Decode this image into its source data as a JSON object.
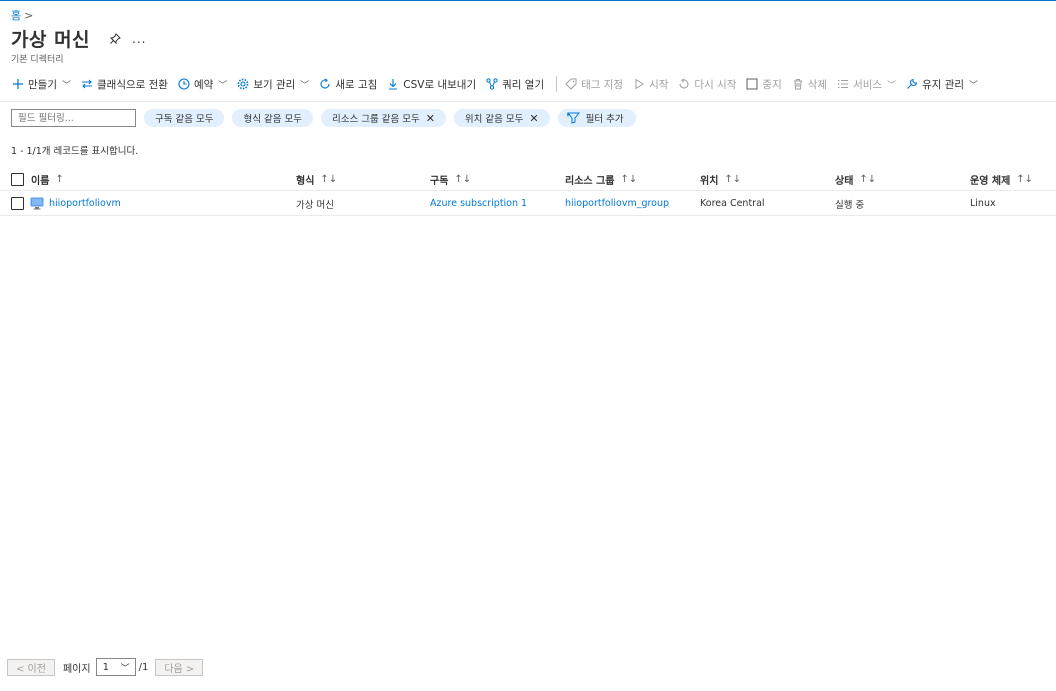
{
  "breadcrumb": {
    "home": "홈",
    "separator": ">"
  },
  "page": {
    "title": "가상 머신",
    "more": "...",
    "subtitle": "기본 디렉터리"
  },
  "toolbar": {
    "create": "만들기",
    "classic": "클래식으로 전환",
    "reservation": "예약",
    "view_manage": "보기 관리",
    "refresh": "새로 고침",
    "export_csv": "CSV로 내보내기",
    "open_query": "쿼리 열기",
    "assign_tags": "태그 지정",
    "start": "시작",
    "restart": "다시 시작",
    "stop": "중지",
    "delete": "삭제",
    "services": "서비스",
    "maintenance": "유지 관리"
  },
  "filters": {
    "placeholder": "필드 필터링...",
    "pills": [
      "구독 같음 모두",
      "형식 같음 모두",
      "리소스 그룹 같음 모두",
      "위치 같음 모두"
    ],
    "add_filter": "필터 추가"
  },
  "records_text": "1 - 1/1개 레코드를 표시합니다.",
  "table": {
    "columns": [
      "이름",
      "형식",
      "구독",
      "리소스 그룹",
      "위치",
      "상태",
      "운영 체제"
    ],
    "sort_name": "↑",
    "sort_other": "↑↓",
    "rows": [
      {
        "name": "hiioportfoliovm",
        "type": "가상 머신",
        "subscription": "Azure subscription 1",
        "resource_group": "hiioportfoliovm_group",
        "location": "Korea Central",
        "status": "실행 중",
        "os": "Linux"
      }
    ]
  },
  "pager": {
    "prev": "< 이전",
    "page_label": "페이지",
    "current": "1",
    "total": "/1",
    "next": "다음 >"
  },
  "colors": {
    "accent": "#0078d4",
    "pill_bg": "#e1efff",
    "disabled": "#a19f9d"
  }
}
